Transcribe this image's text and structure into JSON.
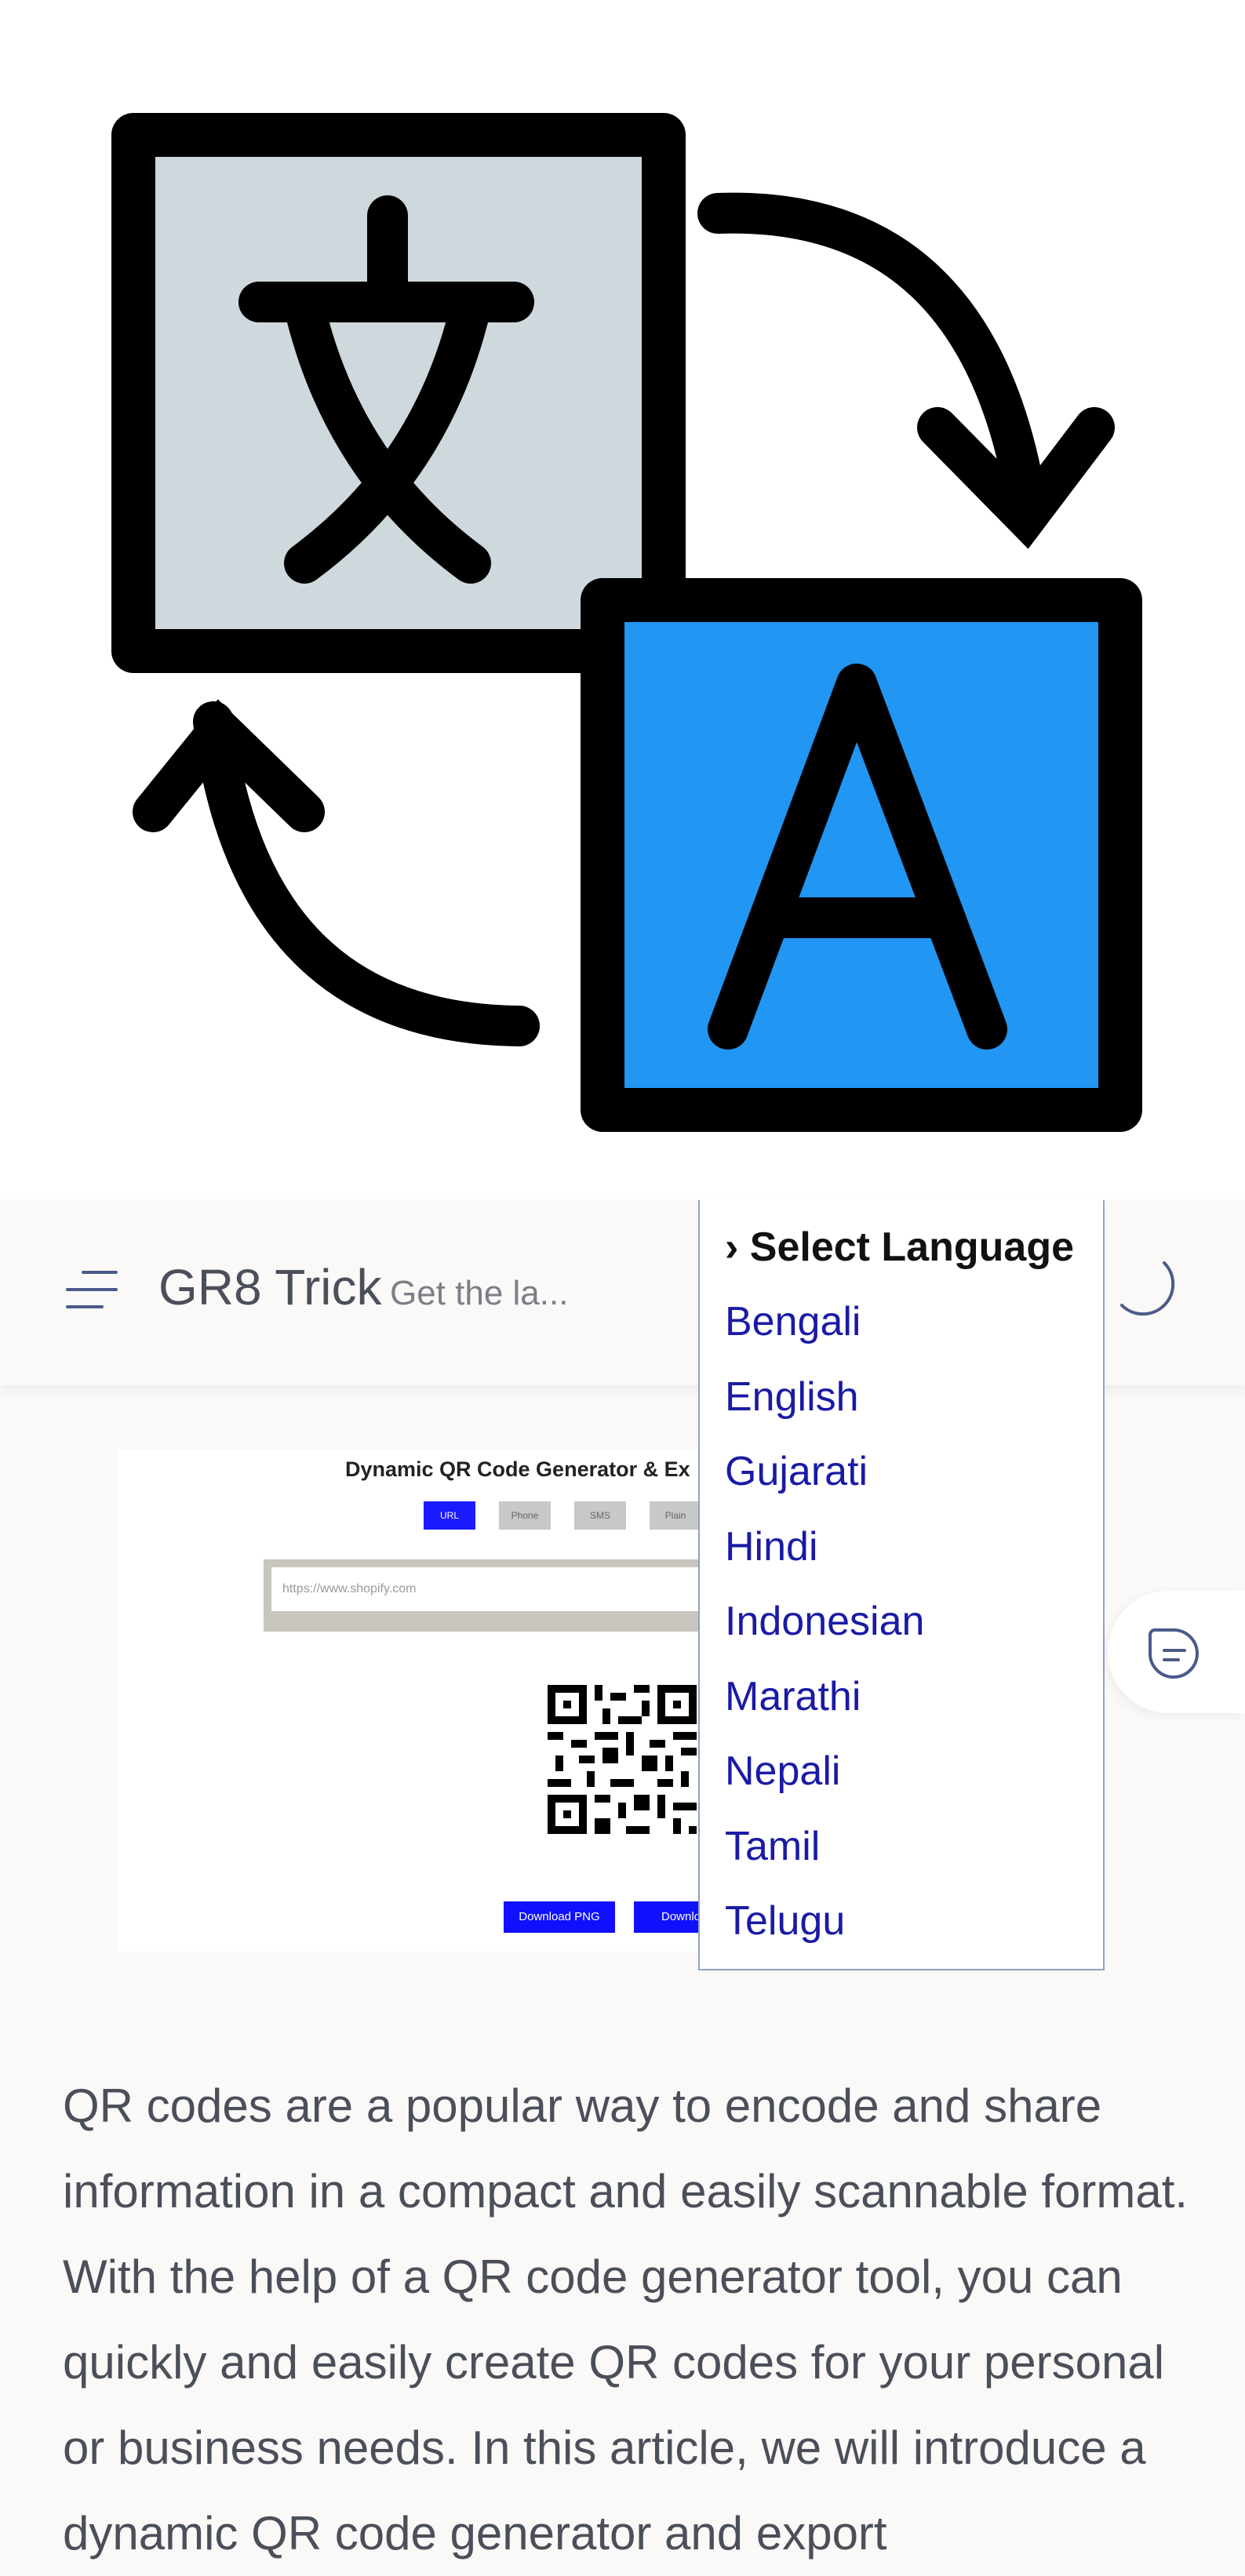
{
  "header": {
    "site_title": "GR8 Trick",
    "tagline": "Get the la..."
  },
  "translate_dropdown": {
    "heading": "› Select Language",
    "languages": [
      "Bengali",
      "English",
      "Gujarati",
      "Hindi",
      "Indonesian",
      "Marathi",
      "Nepali",
      "Tamil",
      "Telugu"
    ]
  },
  "featured_image": {
    "title": "Dynamic QR Code Generator & Ex",
    "tabs": [
      "URL",
      "Phone",
      "SMS",
      "Plain"
    ],
    "input_value": "https://www.shopify.com",
    "buttons": [
      "Download PNG",
      "Downlo"
    ]
  },
  "article": {
    "paragraph": "QR codes are a popular way to encode and share information in a compact and easily scannable format. With the help of a QR code generator tool, you can quickly and easily create QR codes for your personal or business needs. In this article, we will introduce a dynamic QR code generator and export"
  },
  "icons": {
    "hero": "translate-icon",
    "menu": "menu-icon",
    "theme": "moon-icon",
    "side": "comment-icon"
  },
  "colors": {
    "hero_grey": "#cfd8dc",
    "hero_blue": "#2196f3",
    "link_blue": "#1a1aa6",
    "text": "#4a4f5a"
  }
}
